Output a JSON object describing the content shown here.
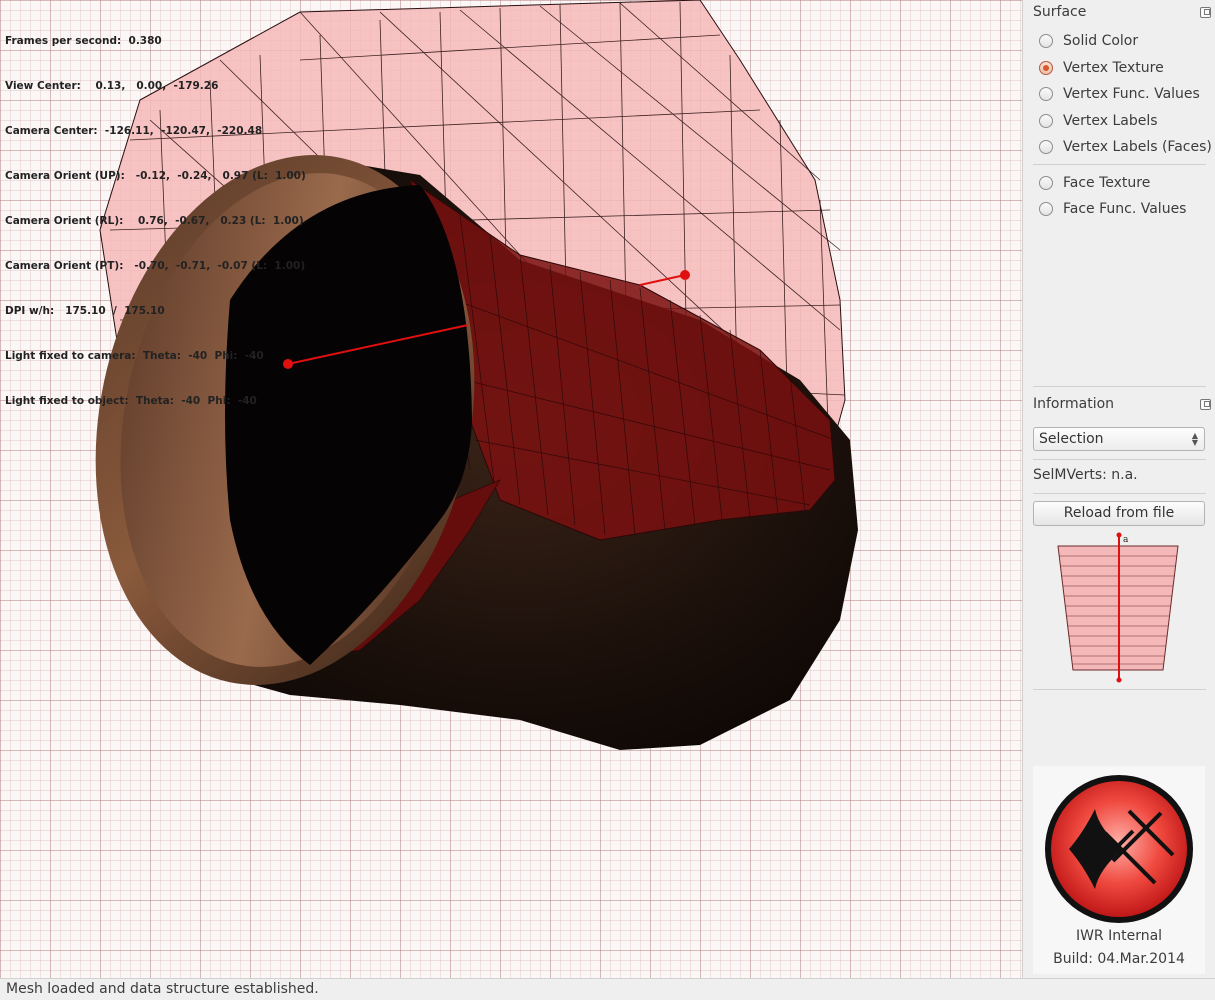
{
  "overlay": {
    "lines": [
      "Frames per second:  0.380",
      "View Center:    0.13,   0.00,  -179.26",
      "Camera Center:  -126.11,  -120.47,  -220.48",
      "Camera Orient (UP):   -0.12,  -0.24,   0.97 (L:  1.00)",
      "Camera Orient (RL):    0.76,  -0.67,   0.23 (L:  1.00)",
      "Camera Orient (PT):   -0.70,  -0.71,  -0.07 (L:  1.00)",
      "DPI w/h:   175.10  /  175.10",
      "Light fixed to camera:  Theta:  -40  Phi:  -40",
      "Light fixed to object:  Theta:  -40  Phi:  -40"
    ]
  },
  "surface": {
    "title": "Surface",
    "options": [
      {
        "label": "Solid Color",
        "checked": false
      },
      {
        "label": "Vertex Texture",
        "checked": true
      },
      {
        "label": "Vertex Func. Values",
        "checked": false
      },
      {
        "label": "Vertex Labels",
        "checked": false
      },
      {
        "label": "Vertex Labels (Faces)",
        "checked": false
      },
      {
        "label": "Face Texture",
        "checked": false
      },
      {
        "label": "Face Func. Values",
        "checked": false
      }
    ]
  },
  "information": {
    "title": "Information",
    "select_value": "Selection",
    "selmverts": "SelMVerts: n.a.",
    "reload_label": "Reload from file",
    "profile_marker": "a"
  },
  "logo": {
    "title": "IWR Internal",
    "build": "Build: 04.Mar.2014"
  },
  "status": {
    "message": "Mesh loaded and data structure established."
  },
  "colors": {
    "mesh_fill": "#f4b8b8",
    "mesh_line": "#2a1010",
    "selection_red": "#e01010",
    "accent": "#d9582b"
  }
}
